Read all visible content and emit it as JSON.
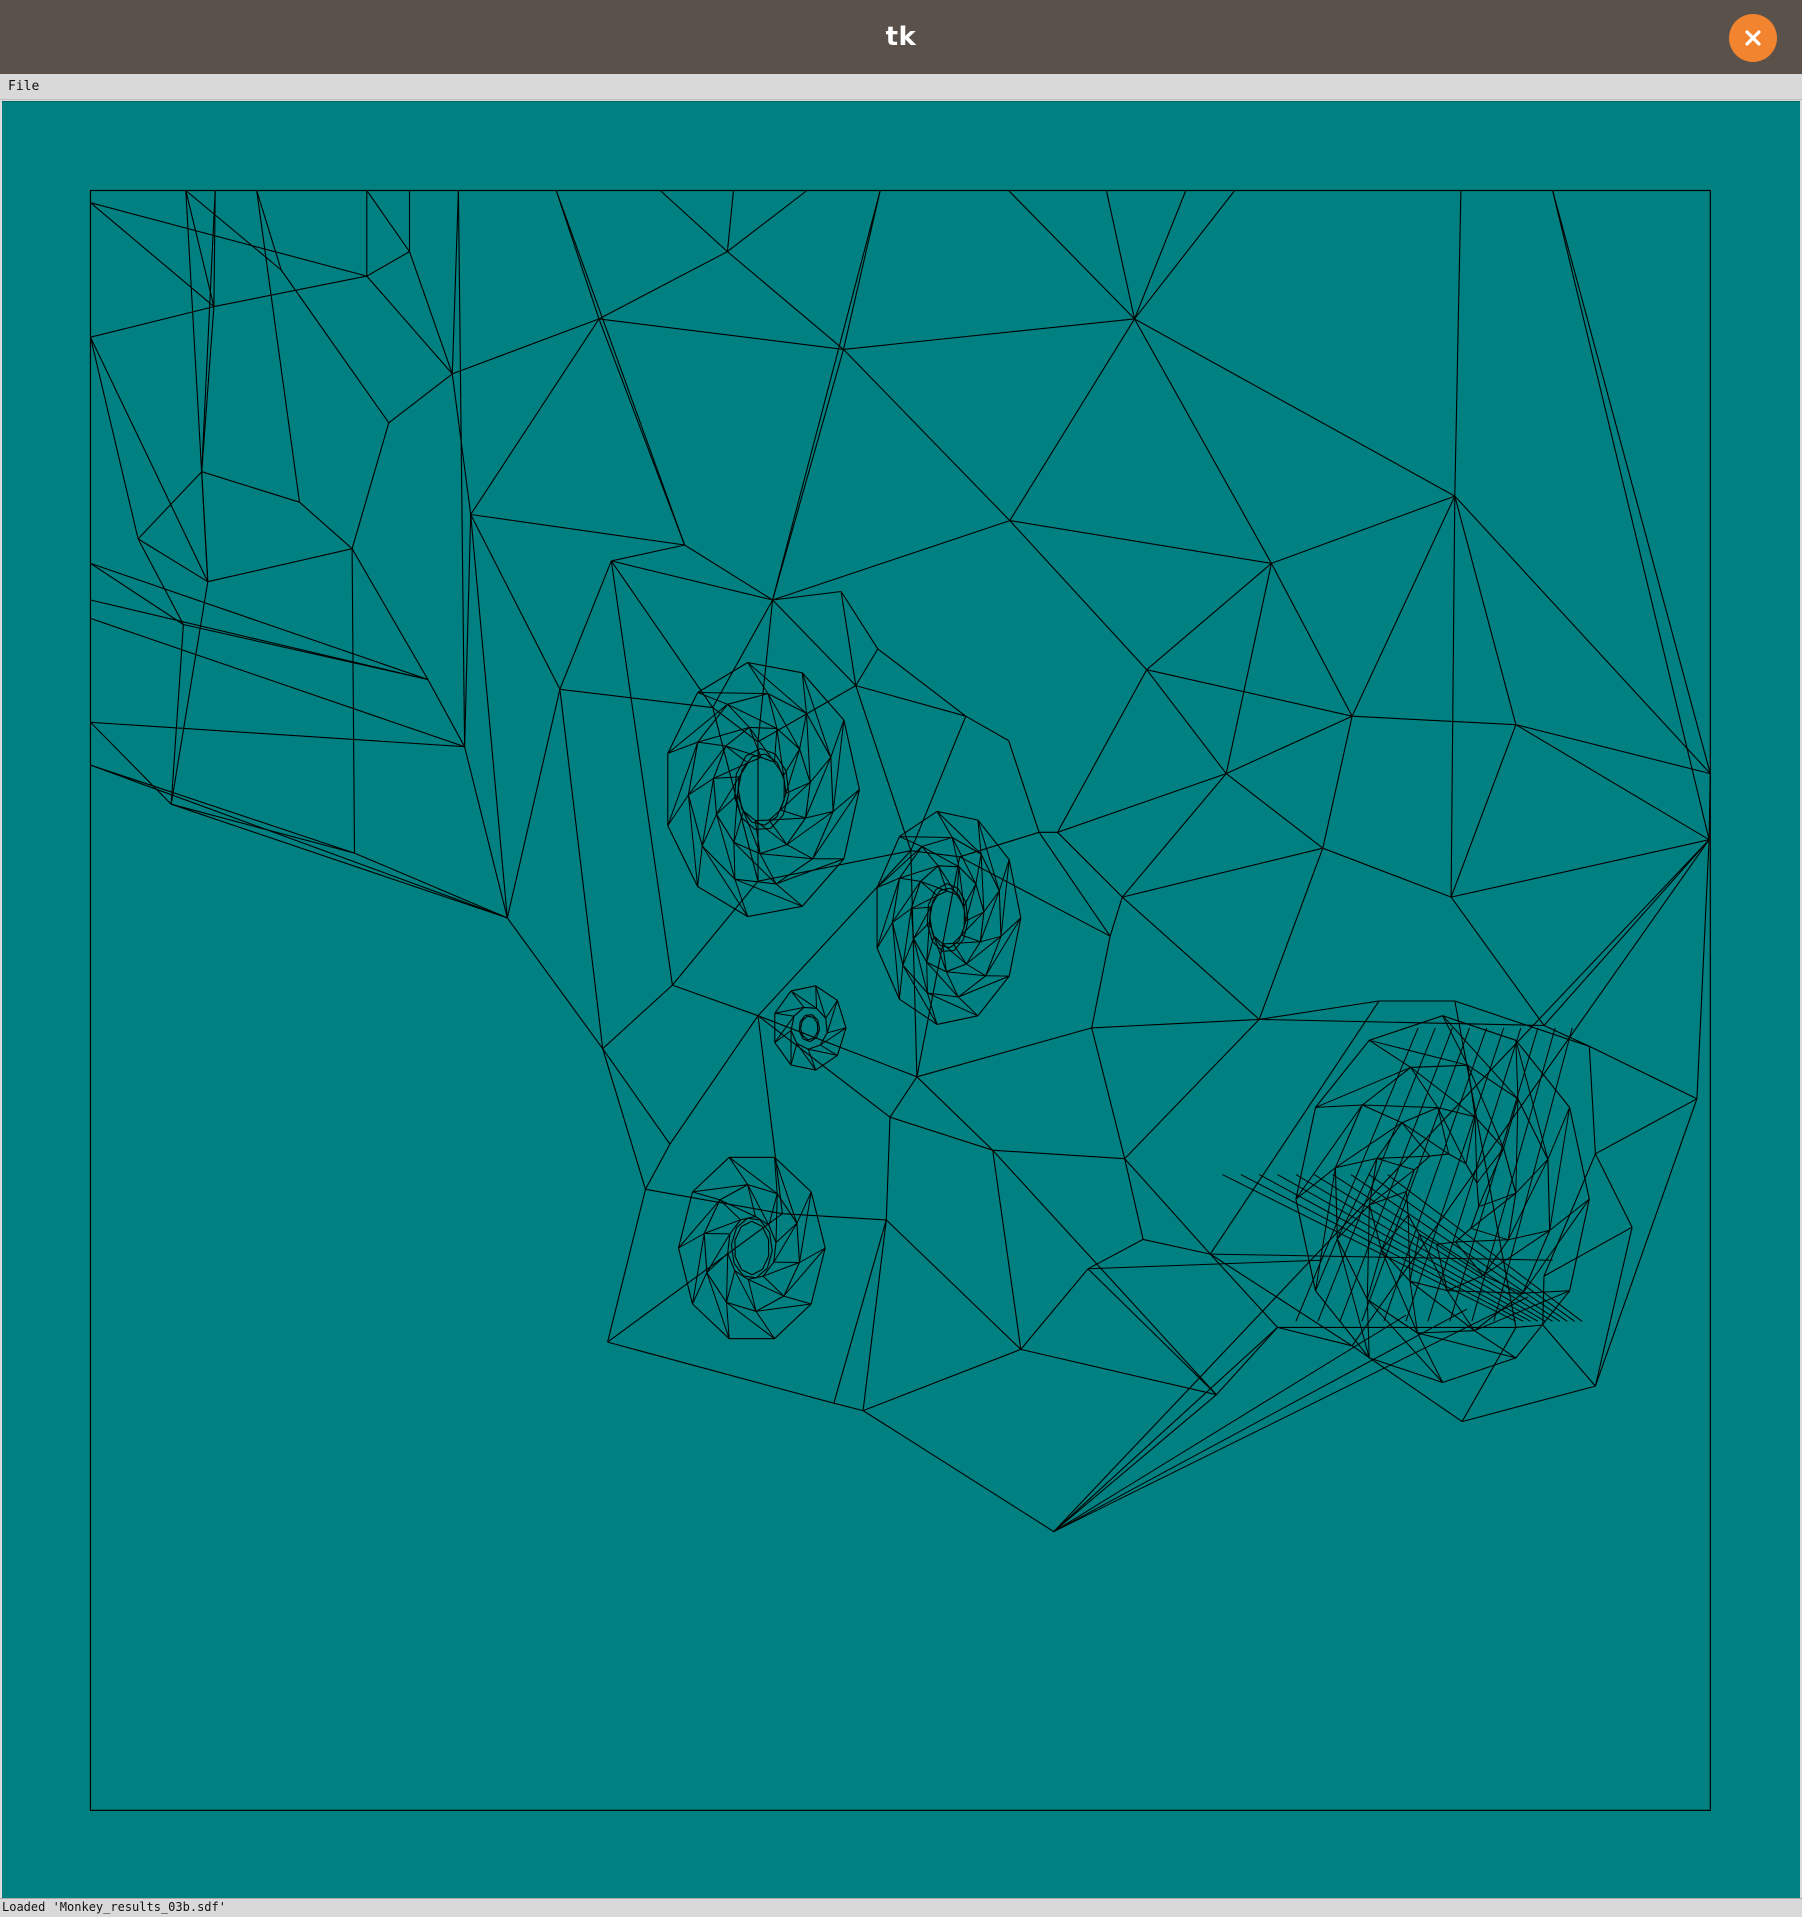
{
  "window": {
    "title": "tk",
    "close_icon": "close-icon",
    "close_color": "#f3842f",
    "titlebar_color": "#5a514b"
  },
  "menu": {
    "items": [
      {
        "label": "File"
      }
    ]
  },
  "canvas": {
    "background": "#008080",
    "line_color": "#000000",
    "content": "wireframe-mesh"
  },
  "status": {
    "text": "Loaded 'Monkey_results_03b.sdf'"
  }
}
